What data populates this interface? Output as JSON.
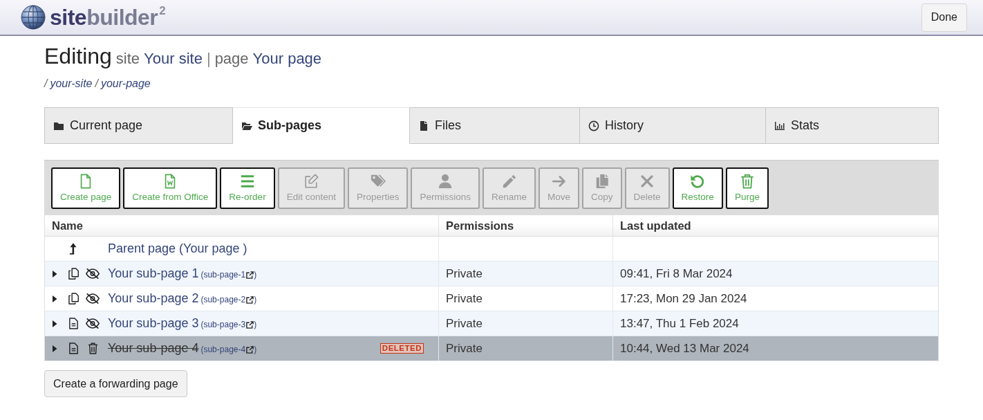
{
  "header": {
    "logo": {
      "name_start": "site",
      "name_end": "builder",
      "superscript": "2"
    },
    "done_button": "Done"
  },
  "heading": {
    "title": "Editing",
    "parts": [
      {
        "kind": "label",
        "text": "site"
      },
      {
        "kind": "link",
        "text": "Your site"
      },
      {
        "kind": "separator",
        "text": "|"
      },
      {
        "kind": "label",
        "text": "page"
      },
      {
        "kind": "link",
        "text": "Your page"
      }
    ]
  },
  "breadcrumb": [
    {
      "separator": "/",
      "text": "your-site"
    },
    {
      "separator": "/",
      "text": "your-page"
    }
  ],
  "tabs": [
    {
      "label": "Current page",
      "selected": false
    },
    {
      "label": "Sub-pages",
      "selected": true
    },
    {
      "label": "Files",
      "selected": false
    },
    {
      "label": "History",
      "selected": false
    },
    {
      "label": "Stats",
      "selected": false
    }
  ],
  "toolbar": [
    {
      "label": "Create page",
      "disabled": false
    },
    {
      "label": "Create from Office",
      "disabled": false
    },
    {
      "label": "Re-order",
      "disabled": false
    },
    {
      "label": "Edit content",
      "disabled": true
    },
    {
      "label": "Properties",
      "disabled": true
    },
    {
      "label": "Permissions",
      "disabled": true
    },
    {
      "label": "Rename",
      "disabled": true
    },
    {
      "label": "Move",
      "disabled": true
    },
    {
      "label": "Copy",
      "disabled": true
    },
    {
      "label": "Delete",
      "disabled": true
    },
    {
      "label": "Restore",
      "disabled": false
    },
    {
      "label": "Purge",
      "disabled": false
    }
  ],
  "table": {
    "columns": [
      "Name",
      "Permissions",
      "Last updated"
    ],
    "rows": [
      {
        "kind": "parent",
        "name": "Parent page (Your page )",
        "selected": false
      },
      {
        "kind": "page",
        "name": "Your sub-page 1",
        "slug": "(sub-page-1",
        "slug_close": ")",
        "expanded": false,
        "has_subpages": true,
        "hidden": true,
        "deleted": false,
        "permissions": "Private",
        "updated": "09:41, Fri 8 Mar 2024",
        "selected": false
      },
      {
        "kind": "page",
        "name": "Your sub-page 2",
        "slug": "(sub-page-2",
        "slug_close": ")",
        "expanded": false,
        "has_subpages": true,
        "hidden": true,
        "deleted": false,
        "permissions": "Private",
        "updated": "17:23, Mon 29 Jan 2024",
        "selected": false
      },
      {
        "kind": "page",
        "name": "Your sub-page 3",
        "slug": "(sub-page-3",
        "slug_close": ")",
        "expanded": false,
        "has_subpages": false,
        "hidden": true,
        "deleted": false,
        "permissions": "Private",
        "updated": "13:47, Thu 1 Feb 2024",
        "selected": false
      },
      {
        "kind": "page",
        "name": "Your sub-page 4",
        "slug": "(sub-page-4",
        "slug_close": ")",
        "expanded": false,
        "has_subpages": false,
        "hidden": false,
        "deleted": true,
        "badge": "DELETED",
        "permissions": "Private",
        "updated": "10:44, Wed 13 Mar 2024",
        "selected": true
      }
    ]
  },
  "forwarding_button": "Create a forwarding page"
}
